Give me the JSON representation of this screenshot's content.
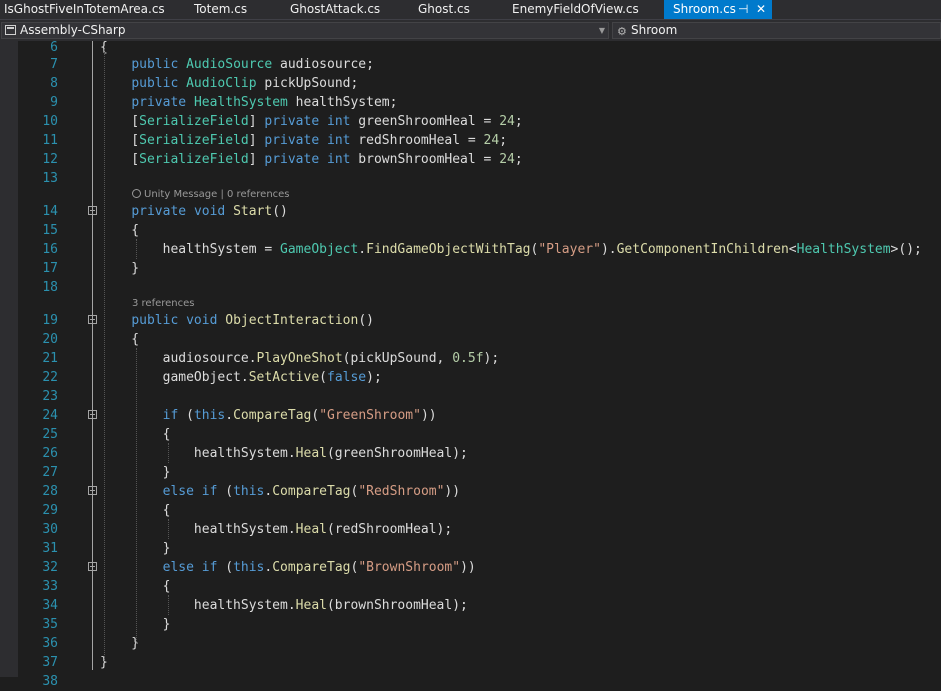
{
  "tabs": [
    {
      "label": "IsGhostFiveInTotemArea.cs",
      "active": false
    },
    {
      "label": "Totem.cs",
      "active": false
    },
    {
      "label": "GhostAttack.cs",
      "active": false
    },
    {
      "label": "Ghost.cs",
      "active": false
    },
    {
      "label": "EnemyFieldOfView.cs",
      "active": false
    },
    {
      "label": "Shroom.cs",
      "active": true
    }
  ],
  "navbar": {
    "project": "Assembly-CSharp",
    "class": "Shroom"
  },
  "colors": {
    "accent": "#007acc",
    "keyword": "#569cd6",
    "type": "#4ec9b0",
    "method": "#dcdcaa",
    "string": "#d69d85",
    "number": "#b5cea8",
    "line_number": "#2b91af"
  },
  "codelens": [
    {
      "unity_message": "Unity Message",
      "separator": " | ",
      "references": "0 references"
    },
    {
      "references": "3 references"
    }
  ],
  "lines": [
    {
      "n": "6",
      "t": [
        [
          "{",
          "p"
        ]
      ]
    },
    {
      "n": "7",
      "t": [
        [
          "    "
        ],
        [
          "public",
          "k"
        ],
        [
          " "
        ],
        [
          "AudioSource",
          "t"
        ],
        [
          " audiosource;"
        ]
      ]
    },
    {
      "n": "8",
      "t": [
        [
          "    "
        ],
        [
          "public",
          "k"
        ],
        [
          " "
        ],
        [
          "AudioClip",
          "t"
        ],
        [
          " pickUpSound;"
        ]
      ]
    },
    {
      "n": "9",
      "t": [
        [
          "    "
        ],
        [
          "private",
          "k"
        ],
        [
          " "
        ],
        [
          "HealthSystem",
          "t"
        ],
        [
          " healthSystem;"
        ]
      ]
    },
    {
      "n": "10",
      "t": [
        [
          "    ["
        ],
        [
          "SerializeField",
          "t"
        ],
        [
          "] "
        ],
        [
          "private",
          "k"
        ],
        [
          " "
        ],
        [
          "int",
          "k"
        ],
        [
          " greenShroomHeal = "
        ],
        [
          "24",
          "n"
        ],
        [
          ";"
        ]
      ]
    },
    {
      "n": "11",
      "t": [
        [
          "    ["
        ],
        [
          "SerializeField",
          "t"
        ],
        [
          "] "
        ],
        [
          "private",
          "k"
        ],
        [
          " "
        ],
        [
          "int",
          "k"
        ],
        [
          " redShroomHeal = "
        ],
        [
          "24",
          "n"
        ],
        [
          ";"
        ]
      ]
    },
    {
      "n": "12",
      "t": [
        [
          "    ["
        ],
        [
          "SerializeField",
          "t"
        ],
        [
          "] "
        ],
        [
          "private",
          "k"
        ],
        [
          " "
        ],
        [
          "int",
          "k"
        ],
        [
          " brownShroomHeal = "
        ],
        [
          "24",
          "n"
        ],
        [
          ";"
        ]
      ]
    },
    {
      "n": "13",
      "t": [
        [
          ""
        ]
      ]
    },
    {
      "n": "14",
      "t": [
        [
          "    "
        ],
        [
          "private",
          "k"
        ],
        [
          " "
        ],
        [
          "void",
          "k"
        ],
        [
          " "
        ],
        [
          "Start",
          "m"
        ],
        [
          "()"
        ]
      ]
    },
    {
      "n": "15",
      "t": [
        [
          "    {"
        ]
      ]
    },
    {
      "n": "16",
      "t": [
        [
          "        healthSystem = "
        ],
        [
          "GameObject",
          "t"
        ],
        [
          "."
        ],
        [
          "FindGameObjectWithTag",
          "m"
        ],
        [
          "("
        ],
        [
          "\"Player\"",
          "s"
        ],
        [
          ")."
        ],
        [
          "GetComponentInChildren",
          "m"
        ],
        [
          "<"
        ],
        [
          "HealthSystem",
          "t"
        ],
        [
          ">();"
        ]
      ]
    },
    {
      "n": "17",
      "t": [
        [
          "    }"
        ]
      ]
    },
    {
      "n": "18",
      "t": [
        [
          ""
        ]
      ]
    },
    {
      "n": "19",
      "t": [
        [
          "    "
        ],
        [
          "public",
          "k"
        ],
        [
          " "
        ],
        [
          "void",
          "k"
        ],
        [
          " "
        ],
        [
          "ObjectInteraction",
          "m"
        ],
        [
          "()"
        ]
      ]
    },
    {
      "n": "20",
      "t": [
        [
          "    {"
        ]
      ]
    },
    {
      "n": "21",
      "t": [
        [
          "        audiosource."
        ],
        [
          "PlayOneShot",
          "m"
        ],
        [
          "(pickUpSound, "
        ],
        [
          "0.5f",
          "n"
        ],
        [
          ");"
        ]
      ]
    },
    {
      "n": "22",
      "t": [
        [
          "        gameObject."
        ],
        [
          "SetActive",
          "m"
        ],
        [
          "("
        ],
        [
          "false",
          "k"
        ],
        [
          ");"
        ]
      ]
    },
    {
      "n": "23",
      "t": [
        [
          ""
        ]
      ]
    },
    {
      "n": "24",
      "t": [
        [
          "        "
        ],
        [
          "if",
          "k"
        ],
        [
          " ("
        ],
        [
          "this",
          "k"
        ],
        [
          "."
        ],
        [
          "CompareTag",
          "m"
        ],
        [
          "("
        ],
        [
          "\"GreenShroom\"",
          "s"
        ],
        [
          "))"
        ]
      ]
    },
    {
      "n": "25",
      "t": [
        [
          "        {"
        ]
      ]
    },
    {
      "n": "26",
      "t": [
        [
          "            healthSystem."
        ],
        [
          "Heal",
          "m"
        ],
        [
          "(greenShroomHeal);"
        ]
      ]
    },
    {
      "n": "27",
      "t": [
        [
          "        }"
        ]
      ]
    },
    {
      "n": "28",
      "t": [
        [
          "        "
        ],
        [
          "else",
          "k"
        ],
        [
          " "
        ],
        [
          "if",
          "k"
        ],
        [
          " ("
        ],
        [
          "this",
          "k"
        ],
        [
          "."
        ],
        [
          "CompareTag",
          "m"
        ],
        [
          "("
        ],
        [
          "\"RedShroom\"",
          "s"
        ],
        [
          "))"
        ]
      ]
    },
    {
      "n": "29",
      "t": [
        [
          "        {"
        ]
      ]
    },
    {
      "n": "30",
      "t": [
        [
          "            healthSystem."
        ],
        [
          "Heal",
          "m"
        ],
        [
          "(redShroomHeal);"
        ]
      ]
    },
    {
      "n": "31",
      "t": [
        [
          "        }"
        ]
      ]
    },
    {
      "n": "32",
      "t": [
        [
          "        "
        ],
        [
          "else",
          "k"
        ],
        [
          " "
        ],
        [
          "if",
          "k"
        ],
        [
          " ("
        ],
        [
          "this",
          "k"
        ],
        [
          "."
        ],
        [
          "CompareTag",
          "m"
        ],
        [
          "("
        ],
        [
          "\"BrownShroom\"",
          "s"
        ],
        [
          "))"
        ]
      ]
    },
    {
      "n": "33",
      "t": [
        [
          "        {"
        ]
      ]
    },
    {
      "n": "34",
      "t": [
        [
          "            healthSystem."
        ],
        [
          "Heal",
          "m"
        ],
        [
          "(brownShroomHeal);"
        ]
      ]
    },
    {
      "n": "35",
      "t": [
        [
          "        }"
        ]
      ]
    },
    {
      "n": "36",
      "t": [
        [
          "    }"
        ]
      ]
    },
    {
      "n": "37",
      "t": [
        [
          "}"
        ]
      ]
    },
    {
      "n": "38",
      "t": [
        [
          ""
        ]
      ]
    }
  ]
}
